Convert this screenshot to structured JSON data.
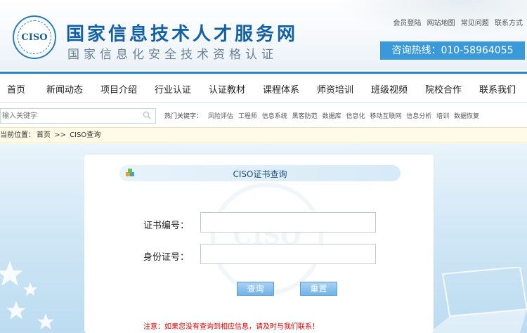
{
  "header": {
    "logo_text": "CISO",
    "title": "国家信息技术人才服务网",
    "subtitle": "国家信息化安全技术资格认证",
    "top_links": [
      "会员登陆",
      "网站地图",
      "常见问题",
      "联系方式"
    ],
    "hotline": "咨询热线：010-58964055"
  },
  "nav": {
    "items": [
      "首页",
      "新闻动态",
      "项目介绍",
      "行业认证",
      "认证教材",
      "课程体系",
      "师资培训",
      "班级视频",
      "院校合作",
      "联系我们"
    ]
  },
  "search": {
    "placeholder": "输入关键字",
    "hot_label": "热门关键字：",
    "hot_words": [
      "风险评估",
      "工程师",
      "信息系统",
      "黑客防范",
      "数据库",
      "信息化",
      "移动互联网",
      "信息分析",
      "培训",
      "数据恢复"
    ]
  },
  "breadcrumb": {
    "label": "当前位置：",
    "home": "首页",
    "separator": ">>",
    "current": "CISO查询"
  },
  "panel": {
    "title": "CISO证书查询",
    "watermark": "CISO",
    "cert_label": "证书编号：",
    "cert_value": "",
    "id_label": "身份证号：",
    "id_value": "",
    "query_button": "查询",
    "reset_button": "重置",
    "notice": "注意：如果您没有查询到相应信息，请及时与我们联系！"
  },
  "colors": {
    "accent": "#1c8ad3",
    "hotline_bg": "#3a9ad9",
    "title_blue": "#1461a8",
    "notice_red": "#e00000",
    "breadcrumb_bg": "#fffbe6"
  }
}
